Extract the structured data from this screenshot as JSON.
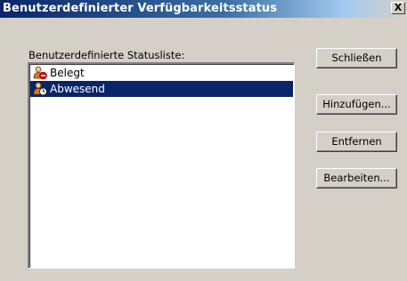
{
  "window": {
    "title": "Benutzerdefinierter Verfügbarkeitsstatus",
    "close_label": "X"
  },
  "list": {
    "label": "Benutzerdefinierte Statusliste:",
    "items": [
      {
        "label": "Belegt",
        "icon": "busy-status-icon",
        "selected": false
      },
      {
        "label": "Abwesend",
        "icon": "away-status-icon",
        "selected": true
      }
    ]
  },
  "buttons": {
    "close": "Schließen",
    "add": "Hinzufügen...",
    "remove": "Entfernen",
    "edit": "Bearbeiten..."
  },
  "colors": {
    "title_bar_start": "#0a246a",
    "title_bar_end": "#a6caf0",
    "selection": "#0a246a",
    "dialog_face": "#d4d0c8"
  }
}
